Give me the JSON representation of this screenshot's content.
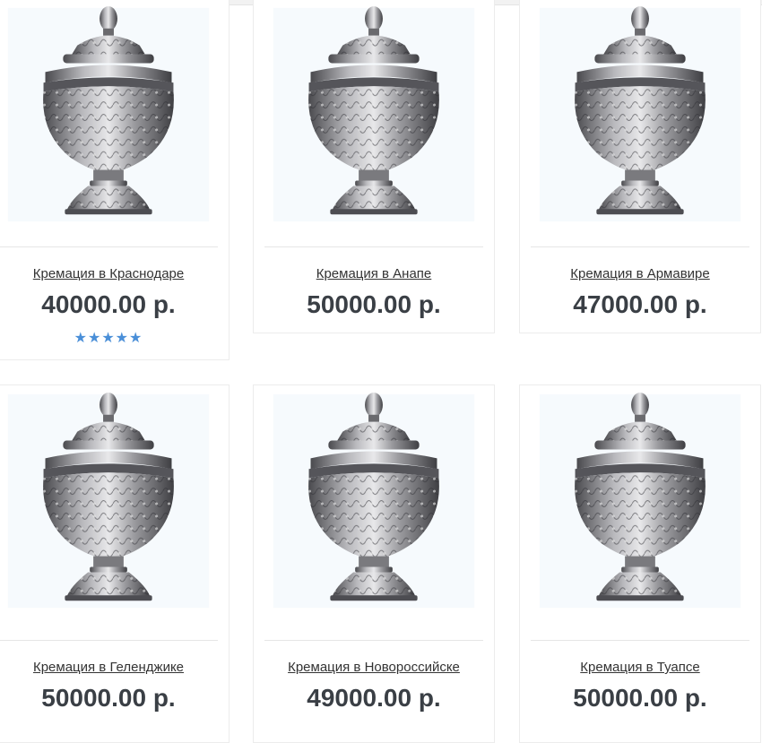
{
  "products": [
    {
      "title": "Кремация в Краснодаре",
      "price": "40000.00 р.",
      "rating": "★★★★★"
    },
    {
      "title": "Кремация в Анапе",
      "price": "50000.00 р."
    },
    {
      "title": "Кремация в Армавире",
      "price": "47000.00 р."
    },
    {
      "title": "Кремация в Геленджике",
      "price": "50000.00 р."
    },
    {
      "title": "Кремация в Новороссийске",
      "price": "49000.00 р."
    },
    {
      "title": "Кремация в Туапсе",
      "price": "50000.00 р."
    }
  ],
  "colors": {
    "price": "#3a3f45",
    "star": "#4a8fd8",
    "link": "#333333"
  },
  "icons": {
    "product_image": "urn-image",
    "rating": "star-icon"
  }
}
